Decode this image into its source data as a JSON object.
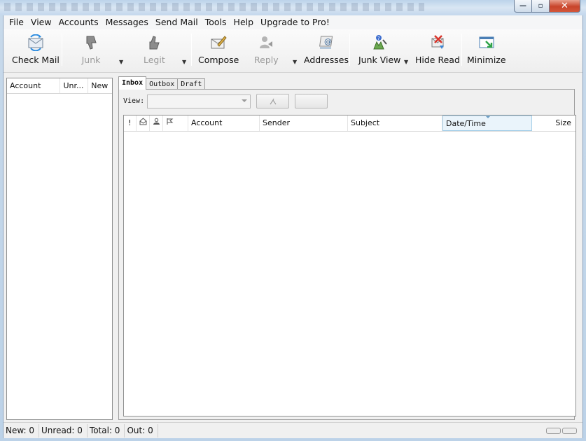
{
  "window": {
    "controls": {
      "minimize": "—",
      "maximize": "▫",
      "close": "✕"
    }
  },
  "menu": [
    "File",
    "View",
    "Accounts",
    "Messages",
    "Send Mail",
    "Tools",
    "Help",
    "Upgrade to Pro!"
  ],
  "toolbar": {
    "check_mail": "Check Mail",
    "junk": "Junk",
    "legit": "Legit",
    "compose": "Compose",
    "reply": "Reply",
    "addresses": "Addresses",
    "junk_view": "Junk View",
    "hide_read": "Hide Read",
    "minimize": "Minimize"
  },
  "accounts_panel": {
    "columns": [
      "Account",
      "Unr...",
      "New"
    ]
  },
  "tabs": [
    "Inbox",
    "Outbox",
    "Draft"
  ],
  "view": {
    "label": "View:",
    "selected": ""
  },
  "message_list": {
    "columns": [
      "!",
      "",
      "",
      "",
      "Account",
      "Sender",
      "Subject",
      "Date/Time",
      "Size"
    ],
    "sorted_column": "Date/Time",
    "rows": []
  },
  "status": {
    "new": "New: 0",
    "unread": "Unread: 0",
    "total": "Total: 0",
    "out": "Out: 0"
  },
  "colors": {
    "sorted_header_bg": "#eaf4fb",
    "close_button": "#c8442a",
    "window_frame": "#bcd2e8"
  }
}
